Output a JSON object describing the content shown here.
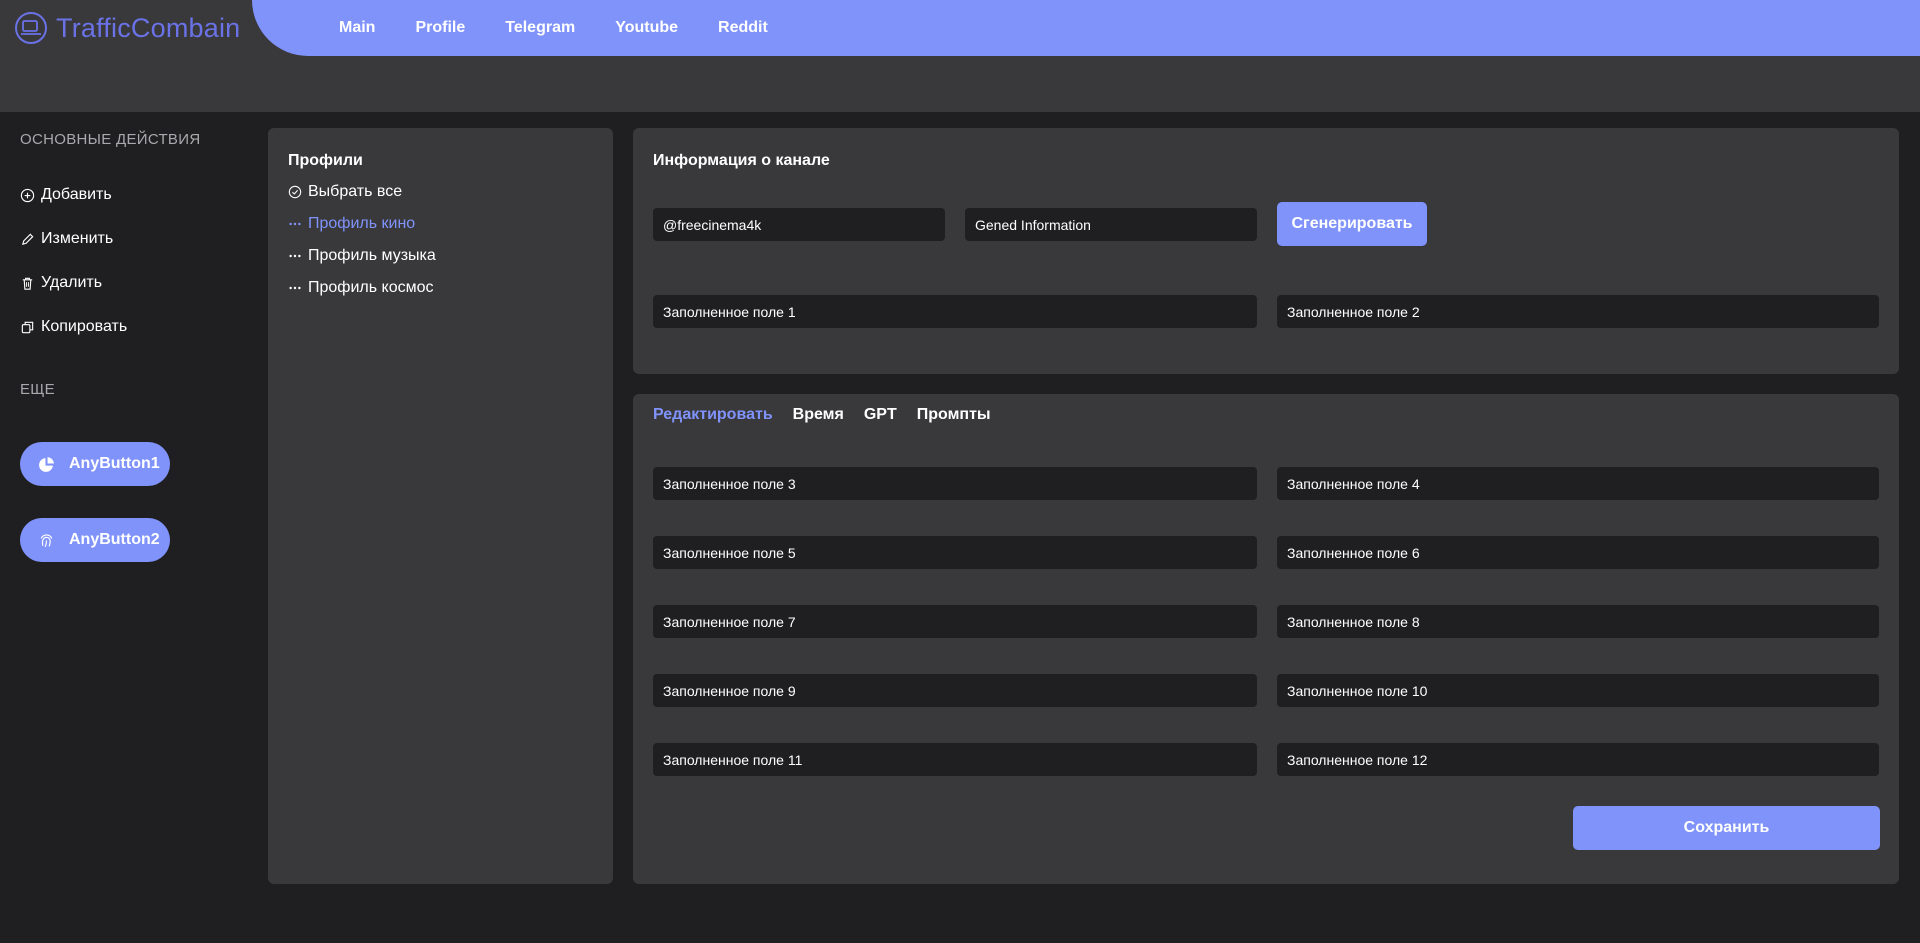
{
  "app": {
    "logo_text": "TrafficCombain"
  },
  "nav": {
    "items": [
      "Main",
      "Profile",
      "Telegram",
      "Youtube",
      "Reddit"
    ]
  },
  "sidebar": {
    "main_heading": "ОСНОВНЫЕ ДЕЙСТВИЯ",
    "actions": [
      "Добавить",
      "Изменить",
      "Удалить",
      "Копировать"
    ],
    "more_heading": "ЕЩЕ",
    "buttons": [
      "AnyButton1",
      "AnyButton2"
    ]
  },
  "profiles": {
    "title": "Профили",
    "select_all": "Выбрать все",
    "items": [
      "Профиль кино",
      "Профиль музыка",
      "Профиль космос"
    ],
    "active_index": 0
  },
  "channel_info": {
    "title": "Информация о канале",
    "handle_value": "@freecinema4k",
    "info_value": "Gened Information",
    "generate_label": "Сгенерировать",
    "field1": "Заполненное поле 1",
    "field2": "Заполненное поле 2"
  },
  "editor": {
    "tabs": [
      "Редактировать",
      "Время",
      "GPT",
      "Промпты"
    ],
    "active_tab": 0,
    "fields": [
      "Заполненное поле 3",
      "Заполненное поле 4",
      "Заполненное поле 5",
      "Заполненное поле 6",
      "Заполненное поле 7",
      "Заполненное поле 8",
      "Заполненное поле 9",
      "Заполненное поле 10",
      "Заполненное поле 11",
      "Заполненное поле 12"
    ],
    "save_label": "Сохранить"
  },
  "colors": {
    "accent": "#8093fb",
    "logo": "#6a72e6",
    "panel": "#39393c",
    "background": "#1f1f21"
  }
}
